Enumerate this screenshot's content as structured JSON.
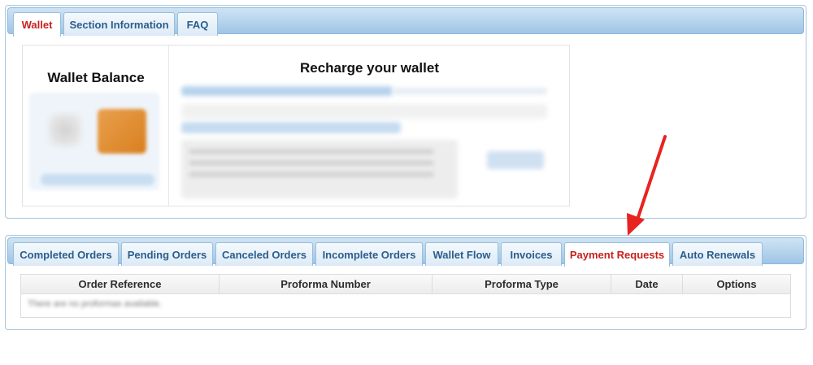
{
  "top_tabs": [
    "Wallet",
    "Section Information",
    "FAQ"
  ],
  "wallet": {
    "balance_title": "Wallet Balance",
    "recharge_title": "Recharge your wallet"
  },
  "bottom_tabs": [
    "Completed Orders",
    "Pending Orders",
    "Canceled Orders",
    "Incomplete Orders",
    "Wallet Flow",
    "Invoices",
    "Payment Requests",
    "Auto Renewals"
  ],
  "active_bottom_tab": "Payment Requests",
  "table": {
    "columns": [
      "Order Reference",
      "Proforma Number",
      "Proforma Type",
      "Date",
      "Options"
    ],
    "empty_text": "There are no proformas available."
  },
  "colors": {
    "active_tab_text": "#c8211d",
    "tab_text": "#2b5d8c",
    "arrow": "#e8231f"
  }
}
